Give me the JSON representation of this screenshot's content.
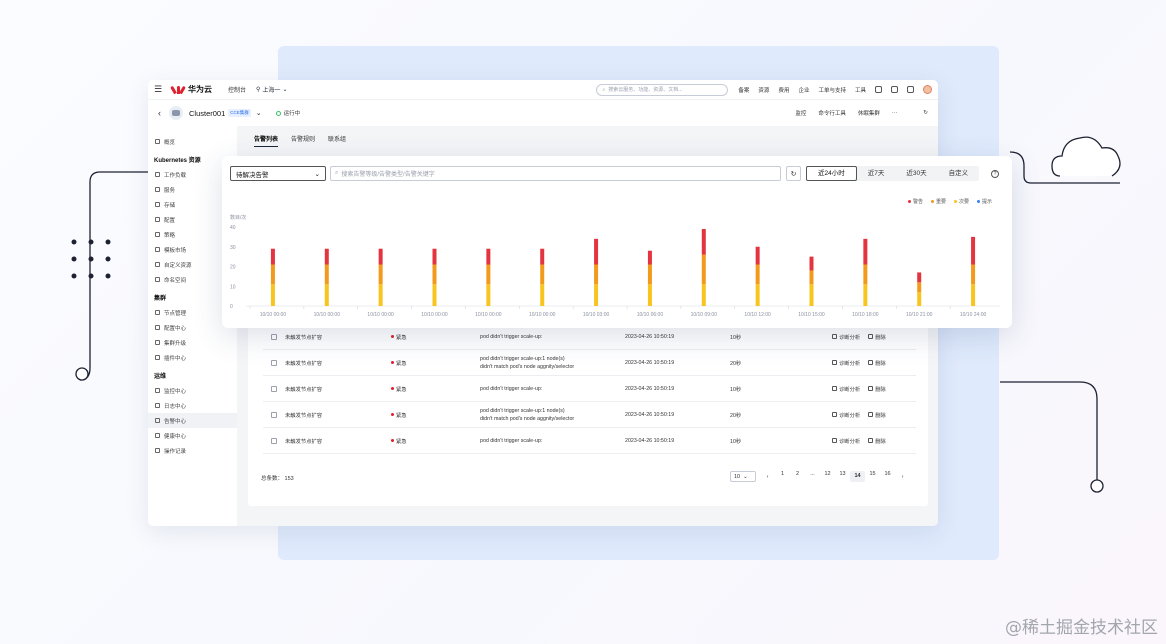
{
  "topbar": {
    "brand": "华为云",
    "console": "控制台",
    "region": "上海一",
    "search_placeholder": "搜索云服务、功能、资源、文档...",
    "items": [
      "备案",
      "资源",
      "费用",
      "企业",
      "工单与支持",
      "工具"
    ]
  },
  "subbar": {
    "cluster": "Cluster001",
    "cluster_tag": "CCE集群",
    "status": "运行中",
    "actions": [
      "监控",
      "命令行工具",
      "休眠集群",
      "···"
    ]
  },
  "sidebar": {
    "overview": "概览",
    "sections": [
      {
        "title": "Kubernetes 资源",
        "items": [
          "工作负载",
          "服务",
          "存储",
          "配置",
          "策略",
          "模板市场",
          "自定义资源",
          "命名空间"
        ]
      },
      {
        "title": "集群",
        "items": [
          "节点管理",
          "配置中心",
          "集群升级",
          "插件中心"
        ]
      },
      {
        "title": "运维",
        "items": [
          "监控中心",
          "日志中心",
          "告警中心",
          "健康中心",
          "操作记录"
        ]
      }
    ],
    "active_item": "告警中心"
  },
  "tabs": [
    "告警列表",
    "告警规则",
    "联系组"
  ],
  "filter": {
    "status_select": "待解决告警",
    "keyword_placeholder": "搜索告警等级/告警类型/告警关键字",
    "ranges": [
      "近24小时",
      "近7天",
      "近30天",
      "自定义"
    ],
    "active_range": "近24小时"
  },
  "chart_data": {
    "type": "bar",
    "stacked": true,
    "ylabel": "数目/次",
    "ylim": [
      0,
      40
    ],
    "yticks": [
      0,
      10,
      20,
      30,
      40
    ],
    "legend": [
      "警告",
      "重要",
      "次要",
      "提示"
    ],
    "legend_placement": "top-right",
    "colors": {
      "critical": "#e3343f",
      "major": "#f29a1c",
      "minor": "#f7c51e",
      "info": "#3a83f0"
    },
    "categories": [
      "10/10 00:00",
      "10/10 00:00",
      "10/10 00:00",
      "10/10 00:00",
      "10/10 00:00",
      "10/10 00:00",
      "10/10 03:00",
      "10/10 06:00",
      "10/10 09:00",
      "10/10 12:00",
      "10/10 15:00",
      "10/10 18:00",
      "10/10 21:00",
      "10/10 24:00"
    ],
    "series": [
      {
        "name": "次要",
        "values": [
          11,
          11,
          11,
          11,
          11,
          11,
          11,
          11,
          11,
          11,
          11,
          11,
          7,
          11
        ]
      },
      {
        "name": "重要",
        "values": [
          10,
          10,
          10,
          10,
          10,
          10,
          10,
          10,
          15,
          10,
          7,
          10,
          5,
          10
        ]
      },
      {
        "name": "警告",
        "values": [
          8,
          8,
          8,
          8,
          8,
          8,
          13,
          7,
          13,
          9,
          7,
          13,
          5,
          14
        ]
      },
      {
        "name": "提示",
        "values": [
          0,
          0,
          0,
          0,
          0,
          0,
          0,
          0,
          0,
          0,
          0,
          0,
          0,
          0
        ]
      }
    ],
    "grid": false
  },
  "table": {
    "rows": [
      {
        "name": "未触发节点扩容",
        "severity": "紧急",
        "desc": [
          "pod didn't trigger scale-up:"
        ],
        "time": "2023-04-26 10:50:19",
        "duration": "10秒"
      },
      {
        "name": "未触发节点扩容",
        "severity": "紧急",
        "desc": [
          "pod didn't trigger scale-up:1 node(s)",
          "didn't match pod's node aggnity/selector"
        ],
        "time": "2023-04-26 10:50:19",
        "duration": "20秒"
      },
      {
        "name": "未触发节点扩容",
        "severity": "紧急",
        "desc": [
          "pod didn't trigger scale-up:"
        ],
        "time": "2023-04-26 10:50:19",
        "duration": "10秒"
      },
      {
        "name": "未触发节点扩容",
        "severity": "紧急",
        "desc": [
          "pod didn't trigger scale-up:1 node(s)",
          "didn't match pod's node aggnity/selector"
        ],
        "time": "2023-04-26 10:50:19",
        "duration": "20秒"
      },
      {
        "name": "未触发节点扩容",
        "severity": "紧急",
        "desc": [
          "pod didn't trigger scale-up:"
        ],
        "time": "2023-04-26 10:50:19",
        "duration": "10秒"
      }
    ],
    "op_diagnose": "诊断分析",
    "op_delete": "删除",
    "total_label": "总条数：",
    "total": "153",
    "page_size": "10",
    "pages": [
      "1",
      "2",
      "...",
      "12",
      "13",
      "14",
      "15",
      "16"
    ],
    "current_page": "14"
  },
  "watermark": "@稀土掘金技术社区"
}
